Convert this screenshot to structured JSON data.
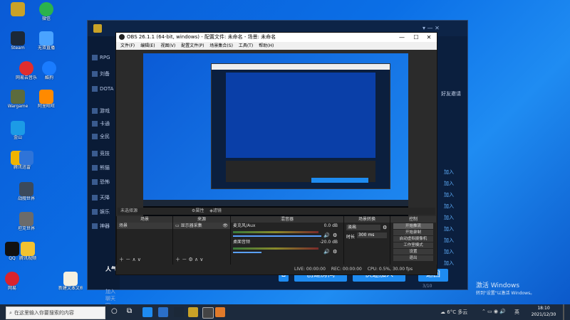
{
  "desktop": {
    "icons": [
      {
        "label": "",
        "color": "#c9a227"
      },
      {
        "label": "微信",
        "color": "#2bb24c"
      },
      {
        "label": "Steam",
        "color": "#1b2838"
      },
      {
        "label": "无双直播",
        "color": "#4aa3ff"
      },
      {
        "label": "网易云音乐",
        "color": "#e02d2d"
      },
      {
        "label": "酷狗",
        "color": "#1a7cff"
      },
      {
        "label": "Wargame",
        "color": "#5c6b3d"
      },
      {
        "label": "阿里旺旺",
        "color": "#ff8a00"
      },
      {
        "label": "金山",
        "color": "#1c9be6"
      },
      {
        "label": "腾讯",
        "color": "#f0b400"
      },
      {
        "label": "迅雷",
        "color": "#2f74d8"
      },
      {
        "label": "战舰世界",
        "color": "#3b4a5c"
      },
      {
        "label": "坦克世界",
        "color": "#6b6b6b"
      },
      {
        "label": "QQ",
        "color": "#111111"
      },
      {
        "label": "腾讯视频",
        "color": "#f2c230"
      },
      {
        "label": "网易",
        "color": "#d9232d"
      },
      {
        "label": "新建文本文档",
        "color": "#f5f0e0"
      }
    ]
  },
  "game": {
    "side_items": [
      "RPG",
      "刘备",
      "DOTA",
      "游戏",
      "卡通",
      "全民",
      "竞技",
      "熊猫",
      "恐怖",
      "天降",
      "娱乐",
      "神器"
    ],
    "right_entries": [
      "加入",
      "加入",
      "加入",
      "加入",
      "加入",
      "加入",
      "加入",
      "加入",
      "加入"
    ],
    "side_extra": "好友邀请",
    "left_bottom": "人气",
    "join_hall": "加入聊天室",
    "btn_create": "创建房间",
    "btn_quick": "快速加入",
    "btn_back": "返回",
    "page": "3/10",
    "accent": "#1e8bf0"
  },
  "obs": {
    "title": "OBS 26.1.1 (64-bit, windows) - 配置文件: 未命名 - 场景: 未命名",
    "menu": [
      "文件(F)",
      "编辑(E)",
      "视图(V)",
      "配置文件(P)",
      "场景集合(S)",
      "工具(T)",
      "帮助(H)"
    ],
    "toolbar_text": "未选择源",
    "props_label": "属性",
    "filter_label": "滤镜",
    "scenes": {
      "header": "场景",
      "item": "场景"
    },
    "sources": {
      "header": "来源",
      "item": "显示器采集"
    },
    "mixer": {
      "header": "混音器",
      "ch1": "麦克风/Aux",
      "ch1_val": "0.0 dB",
      "ch2": "桌面音频",
      "ch2_val": "-20.0 dB"
    },
    "transitions": {
      "header": "场景转换",
      "type": "淡出",
      "duration_label": "时长",
      "duration": "300 ms"
    },
    "controls": {
      "header": "控制",
      "buttons": [
        "开始推流",
        "开始录制",
        "启动虚拟摄像机",
        "工作室模式",
        "设置",
        "退出"
      ]
    },
    "status": {
      "live": "LIVE: 00:00:00",
      "rec": "REC: 00:00:00",
      "cpu": "CPU: 0.5%, 30.00 fps"
    }
  },
  "watermark": {
    "line1": "激活 Windows",
    "line2": "转到\"设置\"以激活 Windows。"
  },
  "taskbar": {
    "search_placeholder": "在这里输入你要搜索的内容",
    "weather": "6°C 多云",
    "lang": "英",
    "time": "18:10",
    "date": "2021/12/30"
  }
}
